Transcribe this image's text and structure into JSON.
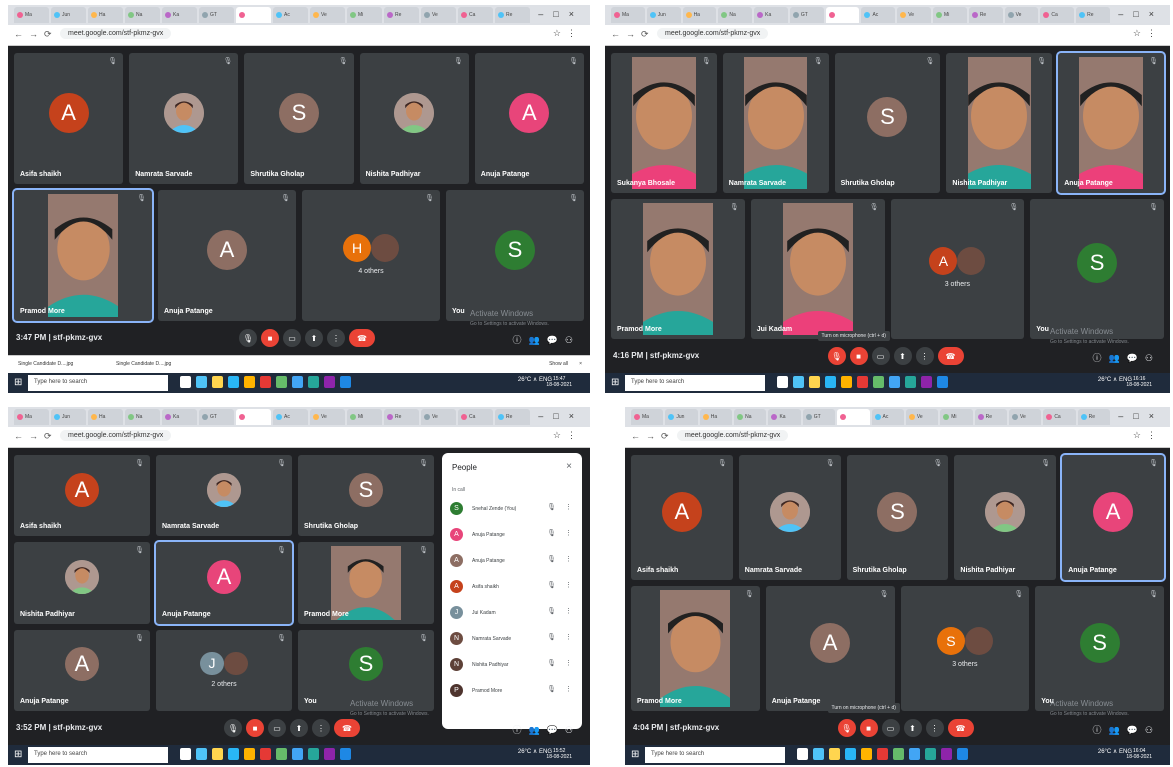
{
  "colors": {
    "meet_bg": "#202124",
    "tile": "#3c4043",
    "highlight": "#8ab4f8",
    "red": "#ea4335",
    "taskbar": "#1f2b3c"
  },
  "url": "meet.google.com/stf-pkmz-gvx",
  "search_placeholder": "Type here to search",
  "tray_text": "26°C ∧ ENG",
  "activate": {
    "title": "Activate Windows",
    "subtitle": "Go to Settings to activate Windows."
  },
  "tabs": [
    "Ma",
    "Jun",
    "Ha",
    "Na",
    "Ka",
    "GT",
    "",
    "Ac",
    "Ve",
    "Mi",
    "Re",
    "Ve",
    "Ca",
    "Re"
  ],
  "screens": [
    {
      "meeting": "3:47 PM  |  stf-pkmz-gvx",
      "tiles": [
        {
          "name": "Asifa shaikh",
          "initial": "A",
          "color": "#c5421c",
          "type": "avatar"
        },
        {
          "name": "Namrata Sarvade",
          "type": "photo"
        },
        {
          "name": "Shrutika Gholap",
          "initial": "S",
          "color": "#8d6e63",
          "type": "avatar"
        },
        {
          "name": "Nishita Padhiyar",
          "type": "photo"
        },
        {
          "name": "Anuja Patange",
          "initial": "A",
          "color": "#e8457a",
          "type": "avatar"
        },
        {
          "name": "Pramod More",
          "type": "video",
          "highlight": true
        },
        {
          "name": "Anuja Patange",
          "initial": "A",
          "color": "#8d6e63",
          "type": "avatar"
        },
        {
          "name": "4 others",
          "initial": "H",
          "color": "#e8710a",
          "type": "group"
        },
        {
          "name": "You",
          "initial": "S",
          "color": "#2e7d32",
          "type": "avatar"
        }
      ],
      "downloads": [
        "Single Candidate D....jpg",
        "Single Candidate D....jpg"
      ],
      "show_all": "Show all",
      "clock": [
        "15:47",
        "18-08-2021"
      ]
    },
    {
      "meeting": "4:16 PM  |  stf-pkmz-gvx",
      "tooltip": "Turn on microphone (ctrl + d)",
      "tiles": [
        {
          "name": "Sukanya Bhosale",
          "type": "video"
        },
        {
          "name": "Namrata Sarvade",
          "type": "video"
        },
        {
          "name": "Shrutika Gholap",
          "initial": "S",
          "color": "#8d6e63",
          "type": "avatar"
        },
        {
          "name": "Nishita Padhiyar",
          "type": "video"
        },
        {
          "name": "Anuja Patange",
          "type": "video",
          "highlight": true
        },
        {
          "name": "Pramod More",
          "type": "video"
        },
        {
          "name": "Jui Kadam",
          "type": "video"
        },
        {
          "name": "3 others",
          "initial": "A",
          "color": "#c5421c",
          "type": "group"
        },
        {
          "name": "You",
          "initial": "S",
          "color": "#2e7d32",
          "type": "avatar"
        }
      ],
      "clock": [
        "16:16",
        "18-08-2021"
      ]
    },
    {
      "meeting": "3:52 PM  |  stf-pkmz-gvx",
      "tiles": [
        {
          "name": "Asifa shaikh",
          "initial": "A",
          "color": "#c5421c",
          "type": "avatar"
        },
        {
          "name": "Namrata Sarvade",
          "type": "photo"
        },
        {
          "name": "Shrutika Gholap",
          "initial": "S",
          "color": "#8d6e63",
          "type": "avatar"
        },
        {
          "name": "Nishita Padhiyar",
          "type": "photo"
        },
        {
          "name": "Anuja Patange",
          "initial": "A",
          "color": "#e8457a",
          "type": "avatar",
          "highlight": true
        },
        {
          "name": "Pramod More",
          "type": "video"
        },
        {
          "name": "Anuja Patange",
          "initial": "A",
          "color": "#8d6e63",
          "type": "avatar"
        },
        {
          "name": "2 others",
          "initial": "J",
          "color": "#78909c",
          "type": "group"
        },
        {
          "name": "You",
          "initial": "S",
          "color": "#2e7d32",
          "type": "avatar"
        }
      ],
      "people": {
        "title": "People",
        "section": "In call",
        "rows": [
          {
            "name": "Snehal Zende (You)",
            "initial": "S",
            "color": "#2e7d32"
          },
          {
            "name": "Anuja Patange",
            "initial": "A",
            "color": "#e8457a"
          },
          {
            "name": "Anuja Patange",
            "initial": "A",
            "color": "#8d6e63"
          },
          {
            "name": "Asifa shaikh",
            "initial": "A",
            "color": "#c5421c"
          },
          {
            "name": "Jui Kadam",
            "initial": "J",
            "color": "#78909c"
          },
          {
            "name": "Namrata Sarvade",
            "initial": "N",
            "color": "#6d4c41"
          },
          {
            "name": "Nishita Padhiyar",
            "initial": "N",
            "color": "#5d4037"
          },
          {
            "name": "Pramod More",
            "initial": "P",
            "color": "#4e342e"
          }
        ]
      },
      "clock": [
        "15:52",
        "18-08-2021"
      ]
    },
    {
      "meeting": "4:04 PM  |  stf-pkmz-gvx",
      "tooltip": "Turn on microphone (ctrl + d)",
      "tiles": [
        {
          "name": "Asifa shaikh",
          "initial": "A",
          "color": "#c5421c",
          "type": "avatar"
        },
        {
          "name": "Namrata Sarvade",
          "type": "photo"
        },
        {
          "name": "Shrutika Gholap",
          "initial": "S",
          "color": "#8d6e63",
          "type": "avatar"
        },
        {
          "name": "Nishita Padhiyar",
          "type": "photo"
        },
        {
          "name": "Anuja Patange",
          "initial": "A",
          "color": "#e8457a",
          "type": "avatar",
          "highlight": true
        },
        {
          "name": "Pramod More",
          "type": "video"
        },
        {
          "name": "Anuja Patange",
          "initial": "A",
          "color": "#8d6e63",
          "type": "avatar"
        },
        {
          "name": "3 others",
          "initial": "S",
          "color": "#e8710a",
          "type": "group"
        },
        {
          "name": "You",
          "initial": "S",
          "color": "#2e7d32",
          "type": "avatar"
        }
      ],
      "clock": [
        "16:04",
        "18-08-2021"
      ]
    }
  ]
}
